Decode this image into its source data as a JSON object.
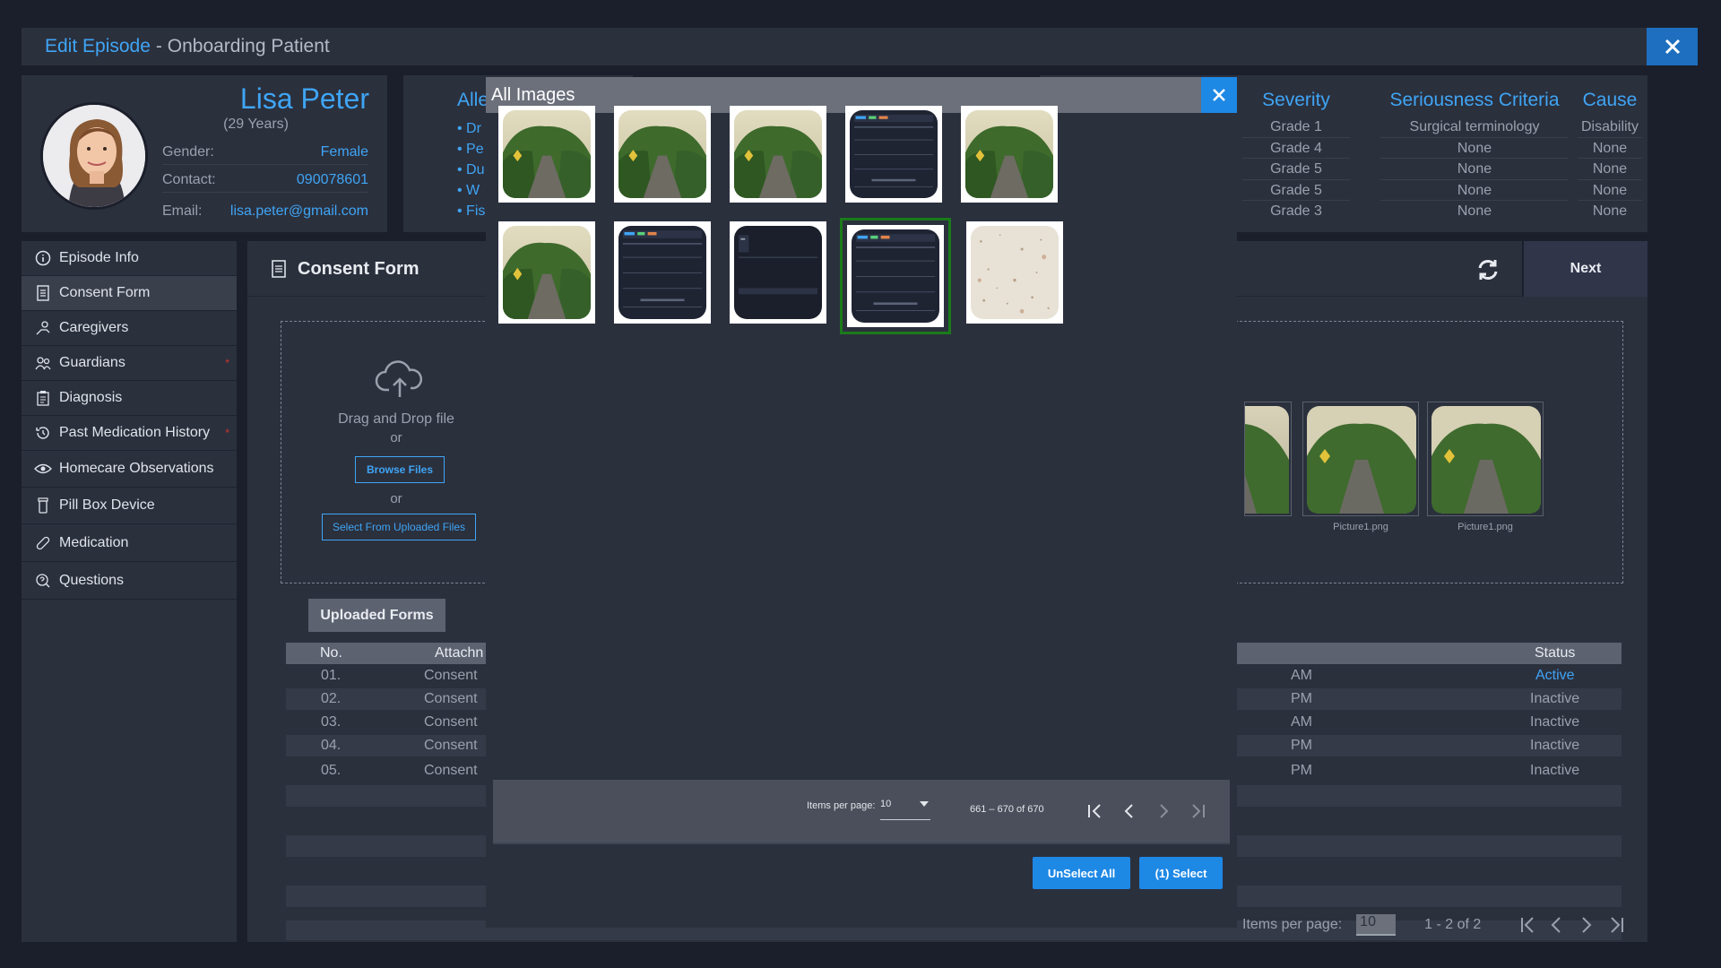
{
  "title": {
    "main": "Edit Episode",
    "separator": " - ",
    "sub": "Onboarding Patient"
  },
  "patient": {
    "name": "Lisa Peter",
    "age": "(29 Years)",
    "gender_label": "Gender:",
    "gender": "Female",
    "contact_label": "Contact:",
    "contact": "090078601",
    "email_label": "Email:",
    "email": "lisa.peter@gmail.com"
  },
  "allergies": {
    "header": "Alle",
    "items": [
      "Dr",
      "Pe",
      "Du",
      "W",
      "Fis"
    ]
  },
  "severity_table": {
    "headers": [
      "Severity",
      "Seriousness Criteria",
      "Cause"
    ],
    "rows": [
      [
        "Grade 1",
        "Surgical terminology",
        "Disability"
      ],
      [
        "Grade 4",
        "None",
        "None"
      ],
      [
        "Grade 5",
        "None",
        "None"
      ],
      [
        "Grade 5",
        "None",
        "None"
      ],
      [
        "Grade 3",
        "None",
        "None"
      ]
    ]
  },
  "sidebar": {
    "items": [
      {
        "label": "Episode Info",
        "icon": "info-icon"
      },
      {
        "label": "Consent Form",
        "icon": "document-icon"
      },
      {
        "label": "Caregivers",
        "icon": "caregivers-icon"
      },
      {
        "label": "Guardians",
        "icon": "guardians-icon"
      },
      {
        "label": "Diagnosis",
        "icon": "clipboard-icon"
      },
      {
        "label": "Past Medication History",
        "icon": "history-icon"
      },
      {
        "label": "Homecare Observations",
        "icon": "observation-icon"
      },
      {
        "label": "Pill Box Device",
        "icon": "pillbox-icon"
      },
      {
        "label": "Medication",
        "icon": "pill-icon"
      },
      {
        "label": "Questions",
        "icon": "questions-icon"
      }
    ],
    "required_mark": "*"
  },
  "consent": {
    "title": "Consent Form",
    "next": "Next",
    "drag_drop": "Drag and Drop file",
    "or": "or",
    "browse": "Browse Files",
    "select_uploaded": "Select From Uploaded Files",
    "file_names": [
      "Picture1.png",
      "Picture1.png"
    ]
  },
  "uploaded_forms": {
    "tab": "Uploaded Forms",
    "headers": {
      "no": "No.",
      "attachment": "Attachn",
      "status": "Status"
    },
    "rows": [
      {
        "no": "01.",
        "attachment": "Consent",
        "time": "AM",
        "status": "Active"
      },
      {
        "no": "02.",
        "attachment": "Consent",
        "time": "PM",
        "status": "Inactive"
      },
      {
        "no": "03.",
        "attachment": "Consent",
        "time": "AM",
        "status": "Inactive"
      },
      {
        "no": "04.",
        "attachment": "Consent",
        "time": "PM",
        "status": "Inactive"
      },
      {
        "no": "05.",
        "attachment": "Consent",
        "time": "PM",
        "status": "Inactive"
      }
    ],
    "pager": {
      "label": "Items per page:",
      "per_page": "10",
      "range": "1 - 2 of 2"
    }
  },
  "modal": {
    "title": "All Images",
    "items": [
      "road",
      "road",
      "road",
      "screen",
      "road",
      "road",
      "screen",
      "dark",
      "screen",
      "texture"
    ],
    "selected_index": 8,
    "pager": {
      "label": "Items per page:",
      "per_page": "10",
      "range": "661 – 670 of 670"
    },
    "unselect_all": "UnSelect All",
    "select": "(1) Select"
  },
  "colors": {
    "accent": "#3fa5f5",
    "close": "#1e6fbf",
    "selected_border": "#1a7a1a",
    "required": "#d0342c"
  }
}
